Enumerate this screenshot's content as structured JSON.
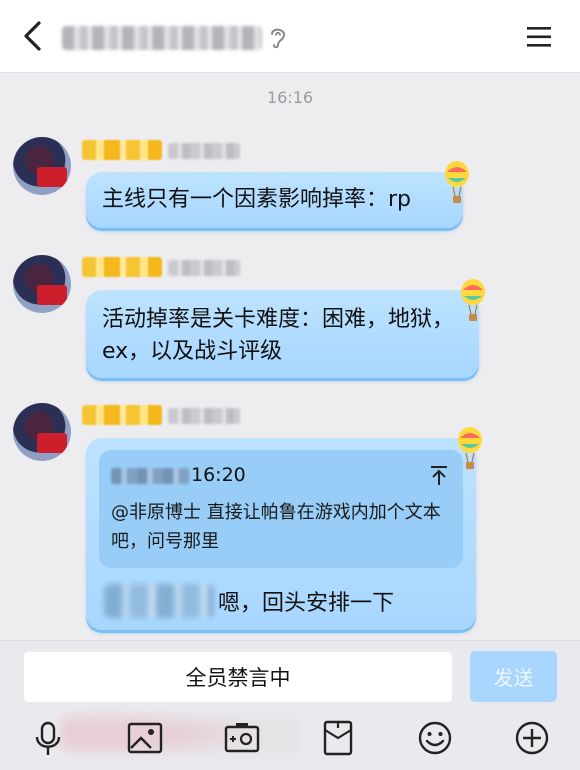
{
  "header": {
    "back_icon": "chevron-left-icon",
    "ear_icon": "earpiece-icon",
    "menu_icon": "hamburger-menu-icon"
  },
  "timestamp": "16:16",
  "messages": [
    {
      "text": "主线只有一个因素影响掉率：rp"
    },
    {
      "text": "活动掉率是关卡难度：困难，地狱，ex，以及战斗评级"
    },
    {
      "quote": {
        "time": "16:20",
        "text": "@非原博士 直接让帕鲁在游戏内加个文本吧，问号那里"
      },
      "reply": "嗯，回头安排一下"
    }
  ],
  "input_bar": {
    "mute_text": "全员禁言中",
    "send_label": "发送"
  },
  "toolbar": [
    {
      "icon": "microphone-icon"
    },
    {
      "icon": "image-icon"
    },
    {
      "icon": "camera-icon"
    },
    {
      "icon": "red-packet-icon"
    },
    {
      "icon": "emoji-icon"
    },
    {
      "icon": "plus-icon"
    }
  ],
  "colors": {
    "bubble": "#a7d6ff",
    "send_button": "#a9d6ff",
    "background": "#ededf0"
  }
}
